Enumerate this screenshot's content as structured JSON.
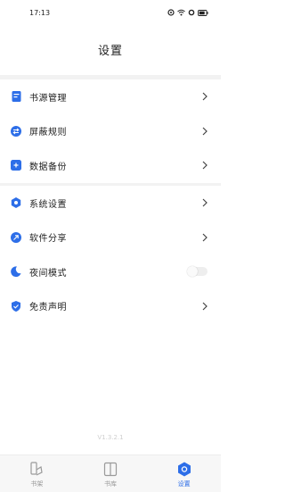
{
  "status_bar": {
    "time": "17:13"
  },
  "page": {
    "title": "设置"
  },
  "groups": [
    {
      "items": [
        {
          "label": "书源管理",
          "icon": "book-source-icon"
        },
        {
          "label": "屏蔽规则",
          "icon": "swap-icon"
        },
        {
          "label": "数据备份",
          "icon": "plus-box-icon"
        }
      ]
    },
    {
      "items": [
        {
          "label": "系统设置",
          "icon": "hexagon-settings-icon"
        },
        {
          "label": "软件分享",
          "icon": "share-arrow-icon"
        },
        {
          "label": "夜间模式",
          "icon": "moon-icon",
          "toggle_on": false
        },
        {
          "label": "免责声明",
          "icon": "shield-check-icon"
        }
      ]
    }
  ],
  "version": "V1.3.2.1",
  "tabbar": {
    "tabs": [
      {
        "label": "书架",
        "icon": "bookshelf-icon",
        "active": false
      },
      {
        "label": "书库",
        "icon": "library-icon",
        "active": false
      },
      {
        "label": "设置",
        "icon": "settings-tab-icon",
        "active": true
      }
    ]
  },
  "colors": {
    "accent": "#2d6ee8",
    "divider_gap": "#f2f2f2"
  }
}
